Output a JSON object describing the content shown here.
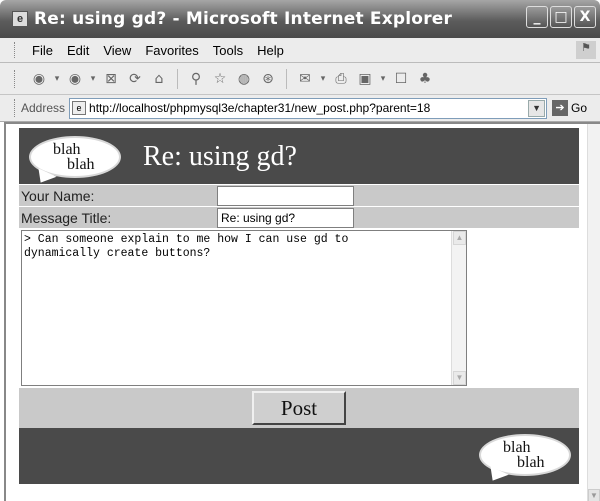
{
  "window": {
    "title": "Re: using gd? - Microsoft Internet Explorer",
    "minimize": "_",
    "maximize": "□",
    "close": "X"
  },
  "menu": [
    "File",
    "Edit",
    "View",
    "Favorites",
    "Tools",
    "Help"
  ],
  "toolbar_icons": [
    "back-icon",
    "forward-icon",
    "stop-icon",
    "refresh-icon",
    "home-icon",
    "search-icon",
    "favorites-icon",
    "media-icon",
    "history-icon",
    "mail-icon",
    "print-icon",
    "edit-icon",
    "discuss-icon",
    "messenger-icon"
  ],
  "address": {
    "label": "Address",
    "url": "http://localhost/phpmysql3e/chapter31/new_post.php?parent=18",
    "go": "Go"
  },
  "page": {
    "logo_line1": "blah",
    "logo_line2": "blah",
    "title": "Re: using gd?",
    "name_label": "Your Name:",
    "name_value": "",
    "title_label": "Message Title:",
    "title_value": "Re: using gd?",
    "message": "> Can someone explain to me how I can use gd to\ndynamically create buttons?",
    "post_label": "Post"
  },
  "colors": {
    "header_bg": "#4a4a4a",
    "form_bg": "#c9c9c9"
  }
}
